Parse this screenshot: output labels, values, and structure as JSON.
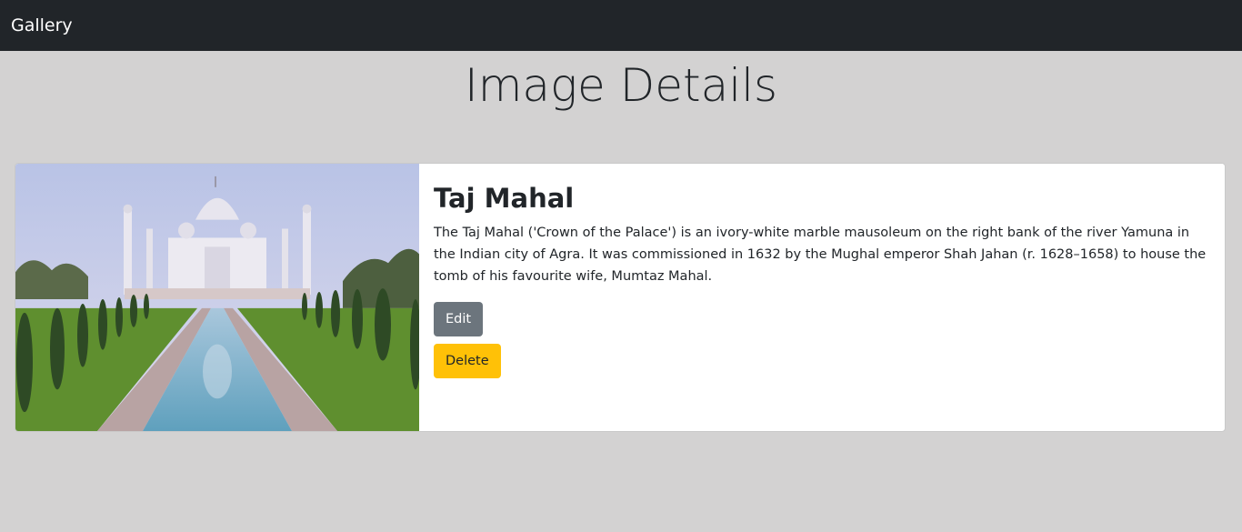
{
  "navbar": {
    "brand": "Gallery"
  },
  "page": {
    "title": "Image Details"
  },
  "image": {
    "title": "Taj Mahal",
    "description": "The Taj Mahal ('Crown of the Palace') is an ivory-white marble mausoleum on the right bank of the river Yamuna in the Indian city of Agra. It was commissioned in 1632 by the Mughal emperor Shah Jahan (r. 1628–1658) to house the tomb of his favourite wife, Mumtaz Mahal.",
    "edit_label": "Edit",
    "delete_label": "Delete"
  },
  "colors": {
    "navbar_bg": "#212529",
    "page_bg": "#d3d2d2",
    "edit_button": "#6c757d",
    "delete_button": "#ffc107"
  }
}
